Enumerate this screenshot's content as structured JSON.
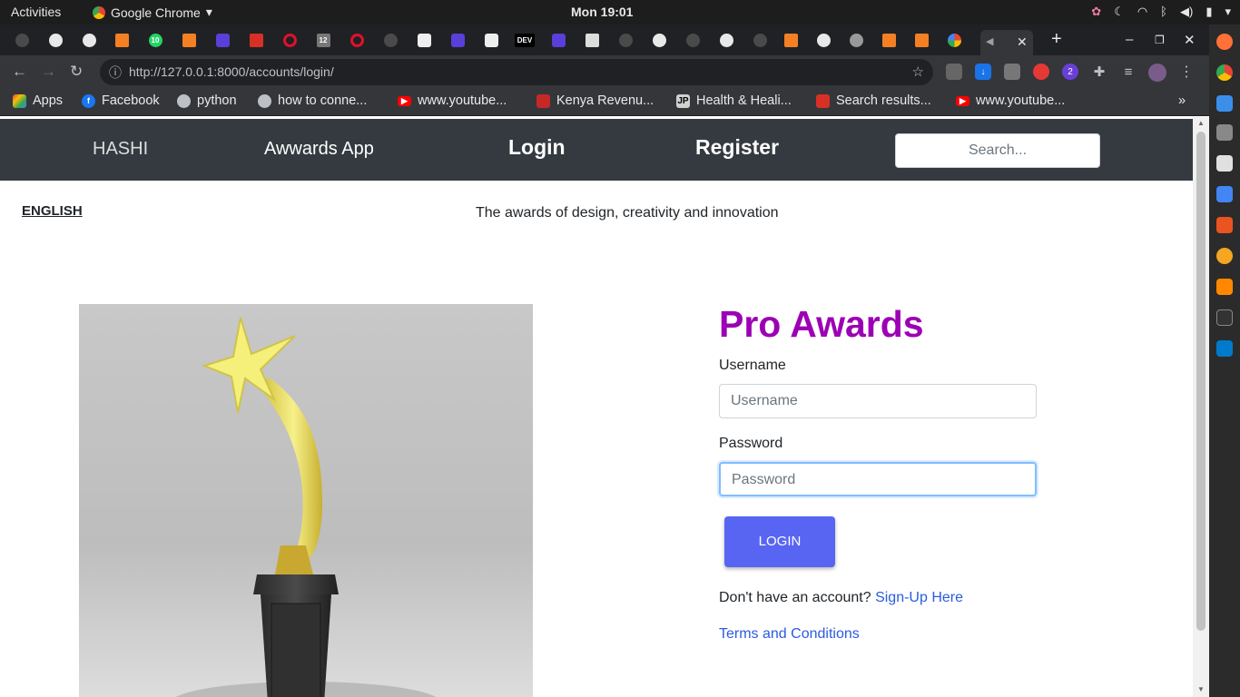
{
  "os": {
    "activities": "Activities",
    "app_name": "Google Chrome",
    "clock": "Mon 19:01",
    "whatsapp_badge": "10"
  },
  "browser": {
    "url": "http://127.0.0.1:8000/accounts/login/",
    "tab_icons": [
      "github-icon",
      "chrome-icon",
      "chrome-icon",
      "stackoverflow-icon",
      "whatsapp-icon",
      "stackoverflow-icon",
      "github-icon",
      "gmail-icon",
      "opera-icon",
      "calendar-icon",
      "opera-icon",
      "github-icon",
      "cube-icon",
      "github-icon",
      "cube-icon",
      "dev-icon",
      "github-icon",
      "image-icon",
      "github-icon",
      "chrome-icon",
      "github-icon",
      "chrome-icon",
      "github-icon",
      "stackoverflow-icon",
      "chrome-icon",
      "chrome-icon",
      "stackoverflow-icon",
      "stackoverflow-icon",
      "google-icon"
    ],
    "dev_tab_label": "DEV",
    "calendar_tab_label": "12",
    "extension_badge": "2"
  },
  "bookmarks": [
    {
      "label": "Apps",
      "icon": "apps-grid-icon"
    },
    {
      "label": "Facebook",
      "icon": "facebook-icon"
    },
    {
      "label": "python",
      "icon": "globe-icon"
    },
    {
      "label": "how to conne...",
      "icon": "globe-icon"
    },
    {
      "label": "www.youtube...",
      "icon": "youtube-icon"
    },
    {
      "label": "Kenya Revenu...",
      "icon": "kra-icon"
    },
    {
      "label": "Health & Heali...",
      "icon": "jp-icon"
    },
    {
      "label": "Search results...",
      "icon": "gmail-icon"
    },
    {
      "label": "www.youtube...",
      "icon": "youtube-icon"
    }
  ],
  "bookmark_jp_label": "JP",
  "nav": {
    "brand": "HASHI",
    "app": "Awwards App",
    "login": "Login",
    "register": "Register",
    "search_placeholder": "Search..."
  },
  "page": {
    "language": "ENGLISH",
    "tagline": "The awards of design, creativity and innovation"
  },
  "form": {
    "title": "Pro Awards",
    "username_label": "Username",
    "username_placeholder": "Username",
    "password_label": "Password",
    "password_placeholder": "Password",
    "login_button": "LOGIN",
    "no_account_text": "Don't have an account?",
    "signup_link": "Sign-Up Here",
    "terms_link": "Terms and Conditions"
  },
  "colors": {
    "brand_title": "#9c00b4",
    "login_button": "#5865f2",
    "link": "#2b5cde",
    "navbar": "#343a40"
  }
}
